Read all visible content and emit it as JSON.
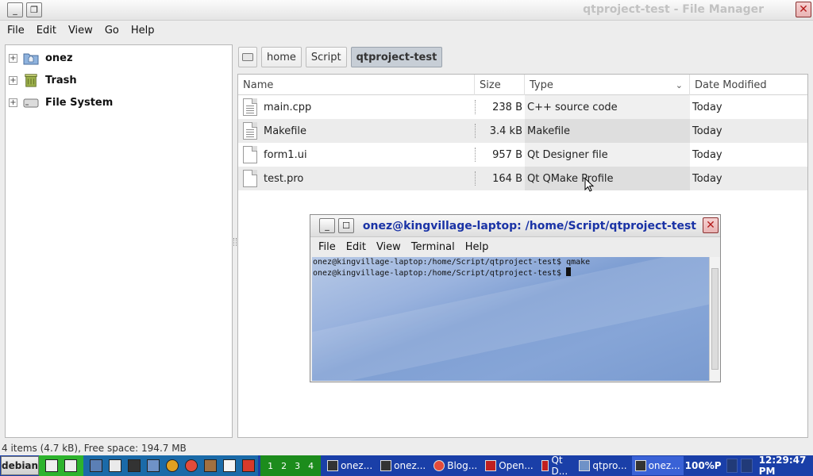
{
  "window": {
    "title": "qtproject-test - File Manager"
  },
  "menubar": [
    "File",
    "Edit",
    "View",
    "Go",
    "Help"
  ],
  "sidebar": {
    "items": [
      {
        "label": "onez",
        "icon": "home-folder-icon"
      },
      {
        "label": "Trash",
        "icon": "trash-icon"
      },
      {
        "label": "File System",
        "icon": "drive-icon"
      }
    ]
  },
  "pathbar": {
    "segments": [
      "home",
      "Script",
      "qtproject-test"
    ]
  },
  "filelist": {
    "columns": {
      "name": "Name",
      "size": "Size",
      "type": "Type",
      "date": "Date Modified"
    },
    "rows": [
      {
        "name": "main.cpp",
        "size": "238 B",
        "type": "C++ source code",
        "date": "Today"
      },
      {
        "name": "Makefile",
        "size": "3.4 kB",
        "type": "Makefile",
        "date": "Today"
      },
      {
        "name": "form1.ui",
        "size": "957 B",
        "type": "Qt Designer file",
        "date": "Today"
      },
      {
        "name": "test.pro",
        "size": "164 B",
        "type": "Qt QMake Profile",
        "date": "Today"
      }
    ]
  },
  "statusbar": {
    "text": "4 items (4.7 kB), Free space: 194.7 MB"
  },
  "terminal": {
    "title": "onez@kingvillage-laptop: /home/Script/qtproject-test",
    "menu": [
      "File",
      "Edit",
      "View",
      "Terminal",
      "Help"
    ],
    "lines": [
      "onez@kingvillage-laptop:/home/Script/qtproject-test$ qmake",
      "onez@kingvillage-laptop:/home/Script/qtproject-test$ "
    ]
  },
  "taskbar": {
    "start_label": "debian",
    "desktops": [
      "1",
      "2",
      "3",
      "4"
    ],
    "tasks": [
      {
        "label": "onez...",
        "active": false
      },
      {
        "label": "onez...",
        "active": false
      },
      {
        "label": "Blog...",
        "active": false
      },
      {
        "label": "Open...",
        "active": false
      },
      {
        "label": "Qt D...",
        "active": false
      },
      {
        "label": "qtpro...",
        "active": false
      },
      {
        "label": "onez...",
        "active": true
      }
    ],
    "battery": "100%P",
    "clock": "12:29:47 PM"
  },
  "colors": {
    "taskbar": "#1a3fa8",
    "quicklaunch": "#2db32d",
    "terminal_title": "#1a33a6",
    "selected_path": "#c7ced6"
  }
}
